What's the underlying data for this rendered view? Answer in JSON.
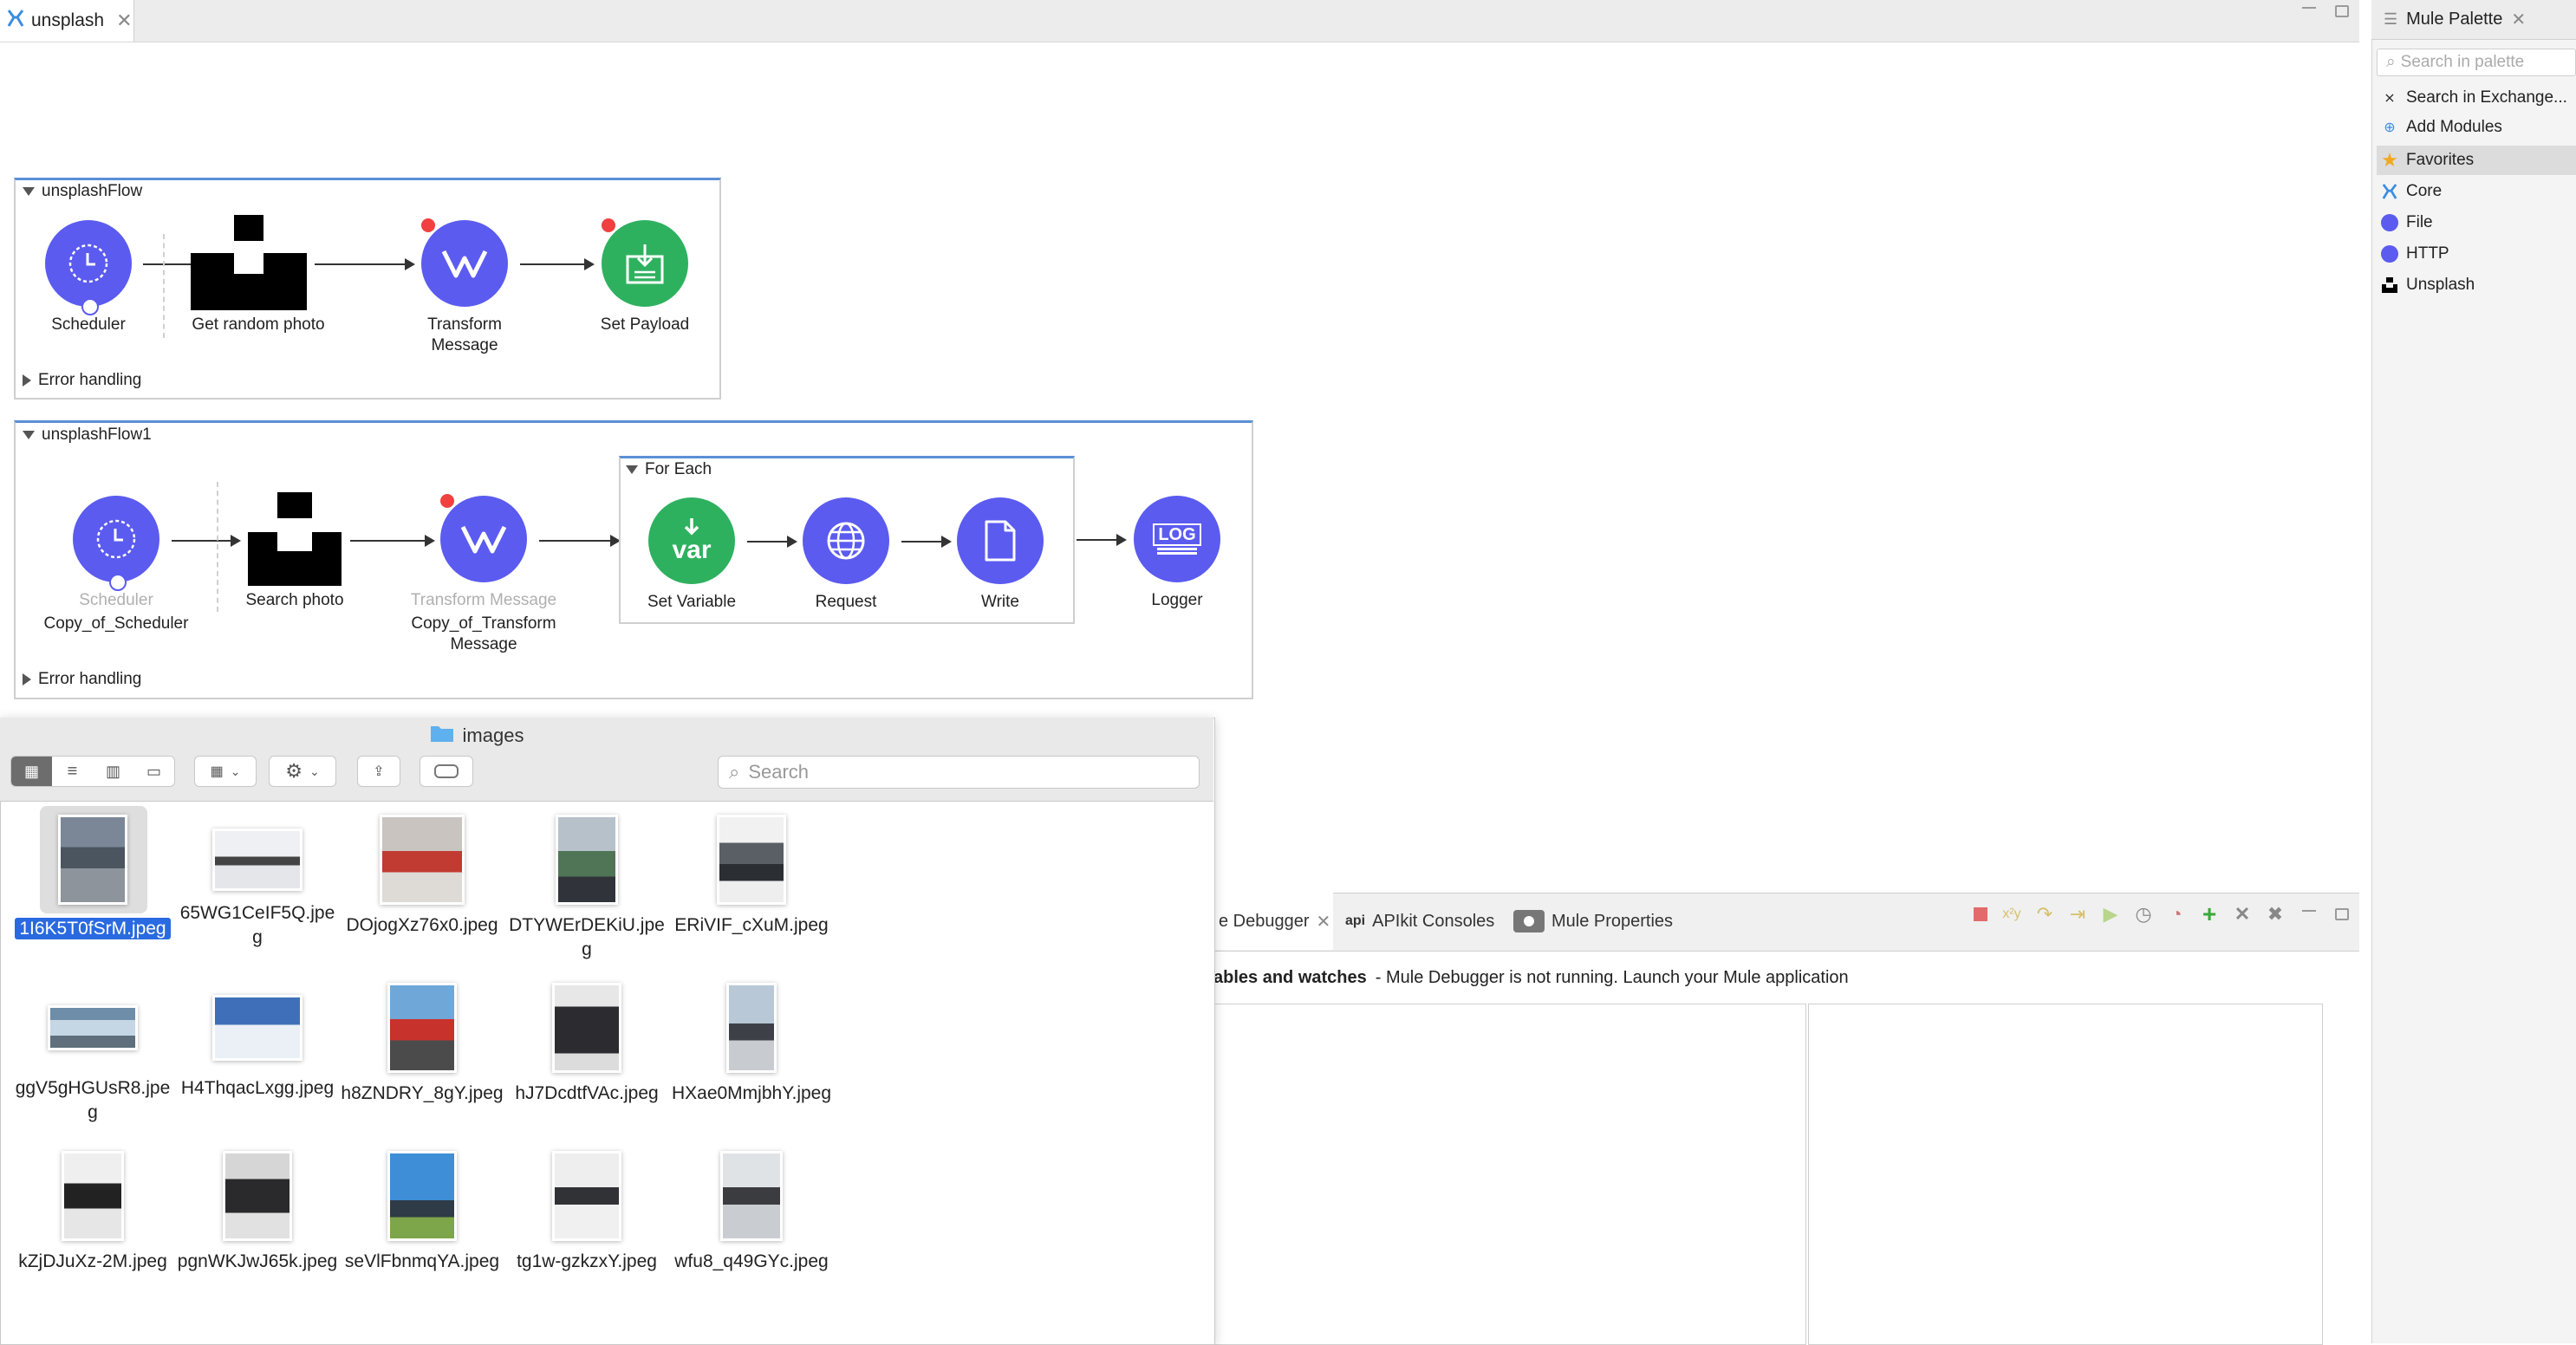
{
  "editor": {
    "tab_label": "unsplash"
  },
  "palette": {
    "title": "Mule Palette",
    "search_placeholder": "Search in palette",
    "items": [
      {
        "label": "Search in Exchange...",
        "icon": "exchange-icon"
      },
      {
        "label": "Add Modules",
        "icon": "add-icon"
      },
      {
        "label": "Favorites",
        "icon": "star-icon"
      },
      {
        "label": "Core",
        "icon": "mule-icon"
      },
      {
        "label": "File",
        "icon": "file-icon"
      },
      {
        "label": "HTTP",
        "icon": "http-icon"
      },
      {
        "label": "Unsplash",
        "icon": "unsplash-icon"
      }
    ]
  },
  "flow1": {
    "name": "unsplashFlow",
    "nodes": {
      "scheduler": "Scheduler",
      "get_photo": "Get random photo",
      "transform": "Transform Message",
      "set_payload": "Set Payload"
    },
    "error_handling": "Error handling"
  },
  "flow2": {
    "name": "unsplashFlow1",
    "nodes": {
      "scheduler_type": "Scheduler",
      "scheduler_name": "Copy_of_Scheduler",
      "search_photo": "Search photo",
      "transform_type": "Transform Message",
      "transform_name": "Copy_of_Transform Message",
      "for_each": "For Each",
      "set_variable": "Set Variable",
      "var_text": "var",
      "request": "Request",
      "write": "Write",
      "logger": "Logger",
      "log_text": "LOG"
    },
    "error_handling": "Error handling"
  },
  "finder": {
    "title": "images",
    "search_placeholder": "Search",
    "files": [
      "1I6K5T0fSrM.jpeg",
      "65WG1CeIF5Q.jpeg",
      "DOjogXz76x0.jpeg",
      "DTYWErDEKiU.jpeg",
      "ERiVIF_cXuM.jpeg",
      "ggV5gHGUsR8.jpeg",
      "H4ThqacLxgg.jpeg",
      "h8ZNDRY_8gY.jpeg",
      "hJ7DcdtfVAc.jpeg",
      "HXae0MmjbhY.jpeg",
      "kZjDJuXz-2M.jpeg",
      "pgnWKJwJ65k.jpeg",
      "seVlFbnmqYA.jpeg",
      "tg1w-gzkzxY.jpeg",
      "wfu8_q49GYc.jpeg"
    ]
  },
  "debugger": {
    "tab_active": "e Debugger",
    "tab_api_prefix": "api",
    "tab_apikit": "APIkit Consoles",
    "tab_props": "Mule Properties",
    "section": "ables and watches",
    "message": "- Mule Debugger is not running. Launch your Mule application"
  },
  "colors": {
    "node_blue": "#5b5bf0",
    "node_green": "#2eb15f",
    "selection": "#2a6ae0",
    "flow_border": "#5b8fd6"
  }
}
